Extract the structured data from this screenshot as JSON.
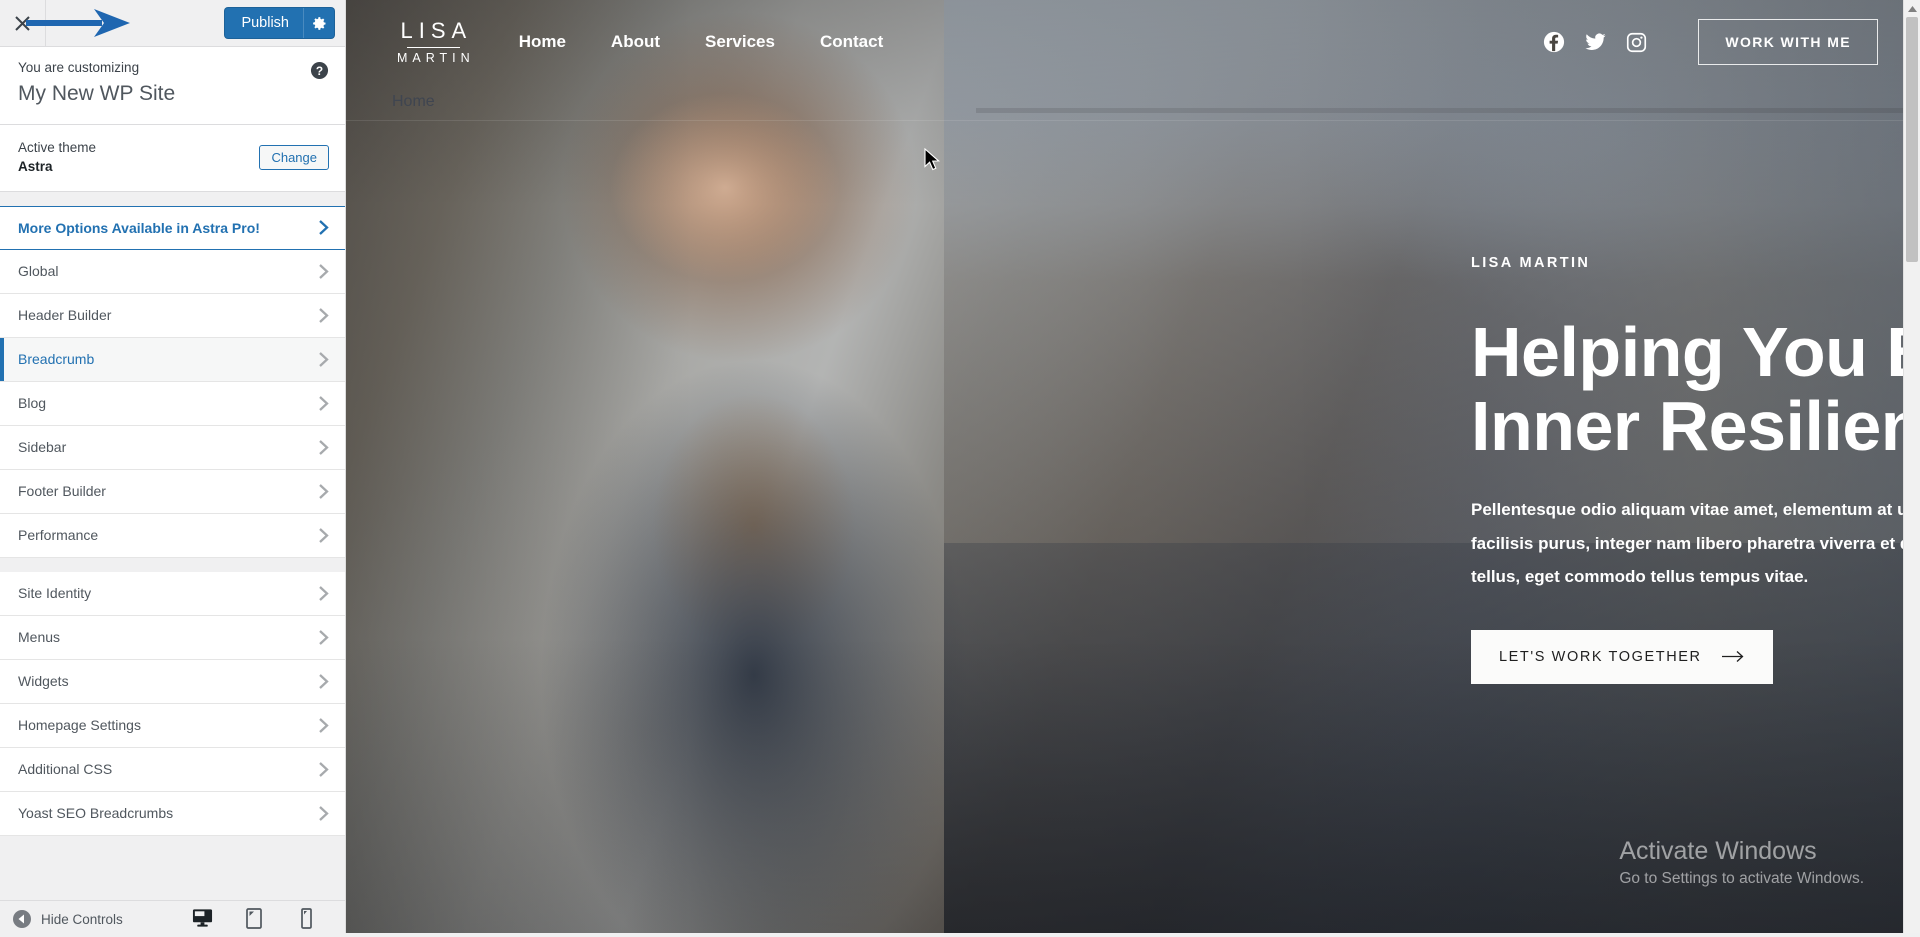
{
  "customizer": {
    "close_icon": "close-x-icon",
    "publish_label": "Publish",
    "publish_settings_icon": "gear-icon",
    "customizing_label": "You are customizing",
    "site_name": "My New WP Site",
    "help_icon": "help-question-icon",
    "active_theme_label": "Active theme",
    "active_theme_name": "Astra",
    "change_button_label": "Change",
    "accent_color": "#2271b1",
    "sections_group_1": [
      {
        "label": "More Options Available in Astra Pro!",
        "style": "pro",
        "chevron": "chevron-right-icon"
      },
      {
        "label": "Global",
        "style": "normal",
        "chevron": "chevron-right-icon"
      },
      {
        "label": "Header Builder",
        "style": "normal",
        "chevron": "chevron-right-icon"
      },
      {
        "label": "Breadcrumb",
        "style": "active",
        "chevron": "chevron-right-icon"
      },
      {
        "label": "Blog",
        "style": "normal",
        "chevron": "chevron-right-icon"
      },
      {
        "label": "Sidebar",
        "style": "normal",
        "chevron": "chevron-right-icon"
      },
      {
        "label": "Footer Builder",
        "style": "normal",
        "chevron": "chevron-right-icon"
      },
      {
        "label": "Performance",
        "style": "normal",
        "chevron": "chevron-right-icon"
      }
    ],
    "sections_group_2": [
      {
        "label": "Site Identity",
        "style": "normal",
        "chevron": "chevron-right-icon"
      },
      {
        "label": "Menus",
        "style": "normal",
        "chevron": "chevron-right-icon"
      },
      {
        "label": "Widgets",
        "style": "normal",
        "chevron": "chevron-right-icon"
      },
      {
        "label": "Homepage Settings",
        "style": "normal",
        "chevron": "chevron-right-icon"
      },
      {
        "label": "Additional CSS",
        "style": "normal",
        "chevron": "chevron-right-icon"
      },
      {
        "label": "Yoast SEO Breadcrumbs",
        "style": "normal",
        "chevron": "chevron-right-icon"
      }
    ],
    "footer": {
      "hide_controls_label": "Hide Controls",
      "collapse_icon": "collapse-left-icon",
      "devices": [
        {
          "name": "desktop",
          "icon": "desktop-icon",
          "active": true
        },
        {
          "name": "tablet",
          "icon": "tablet-icon",
          "active": false
        },
        {
          "name": "mobile",
          "icon": "mobile-icon",
          "active": false
        }
      ]
    }
  },
  "preview": {
    "brand": {
      "line1": "LISA",
      "line2": "MARTIN"
    },
    "nav": [
      {
        "label": "Home"
      },
      {
        "label": "About"
      },
      {
        "label": "Services"
      },
      {
        "label": "Contact"
      }
    ],
    "socials": [
      {
        "name": "facebook-icon"
      },
      {
        "name": "twitter-icon"
      },
      {
        "name": "instagram-icon"
      }
    ],
    "work_button_label": "WORK WITH ME",
    "breadcrumb": "Home",
    "hero": {
      "eyebrow": "LISA MARTIN",
      "heading_line1": "Helping You Build",
      "heading_line2": "Inner Resilience.",
      "paragraph": "Pellentesque odio aliquam vitae amet, elementum at urna facilisis purus, integer nam libero pharetra viverra et dolor tellus, eget commodo tellus tempus vitae.",
      "cta_label": "LET'S WORK TOGETHER",
      "cta_icon": "arrow-right-icon"
    },
    "watermark": {
      "title": "Activate Windows",
      "subtitle": "Go to Settings to activate Windows."
    }
  }
}
